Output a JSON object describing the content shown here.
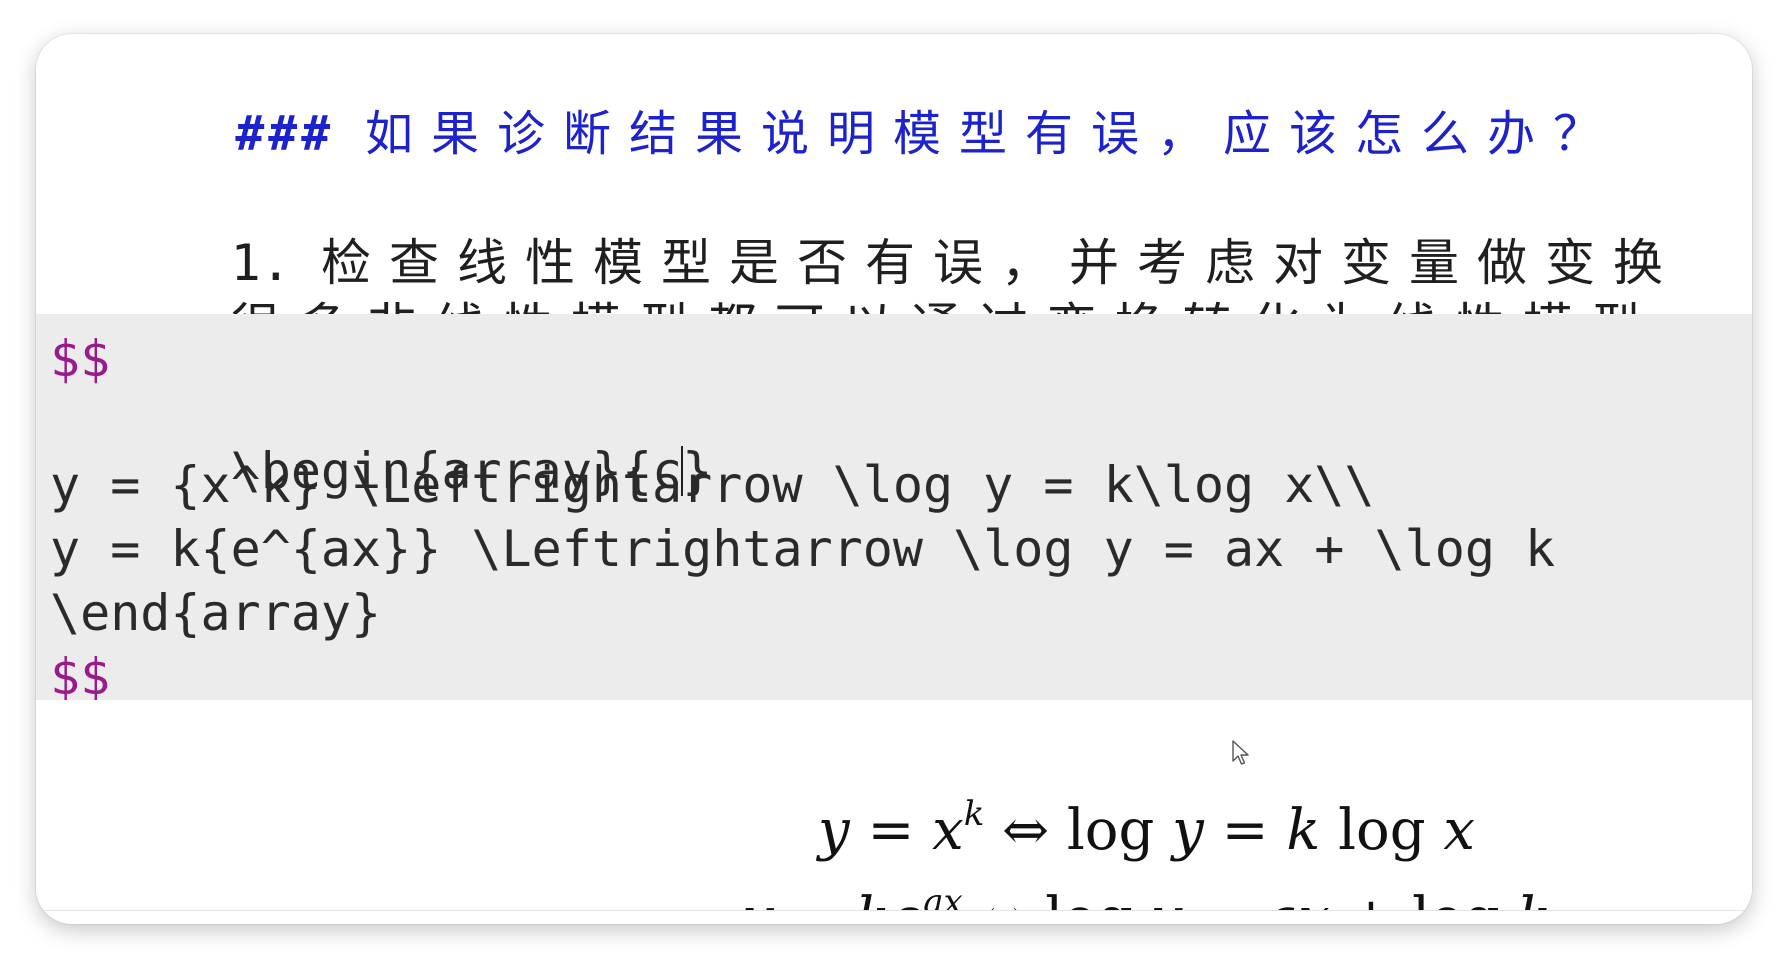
{
  "editor": {
    "heading_hash": "###",
    "heading_text": "如果诊断结果说明模型有误，应该怎么办？",
    "item_number": "1.",
    "item_text": "检查线性模型是否有误，并考虑对变量做变换",
    "line2": "很多非线性模型都可以通过变换转化为线性模型",
    "math_open": "$$",
    "code_begin_pre": "\\begin{array}{c",
    "code_begin_post": "}",
    "code_line1": "y = {x^k} \\Leftrightarrow \\log y = k\\log x\\\\",
    "code_line2": "y = k{e^{ax}} \\Leftrightarrow \\log y = ax + \\log k",
    "code_end": "\\end{array}",
    "math_close": "$$"
  },
  "preview": {
    "eq1_y": "y",
    "eq1_eq": " = ",
    "eq1_x": "x",
    "eq1_k": "k",
    "eq1_rest_a": " ⇔ log ",
    "eq1_y2": "y",
    "eq1_eq2": " = ",
    "eq1_k2": "k",
    "eq1_log": " log ",
    "eq1_x2": "x",
    "eq2_y": "y",
    "eq2_eq": " = ",
    "eq2_k": "ke",
    "eq2_ax": "ax",
    "eq2_rest_a": " ⇔ log ",
    "eq2_y2": "y",
    "eq2_eq2": " = ",
    "eq2_ax2": "ax",
    "eq2_plus": " + log ",
    "eq2_k2": "k"
  },
  "icons": {
    "cursor": "mouse-pointer-icon"
  }
}
